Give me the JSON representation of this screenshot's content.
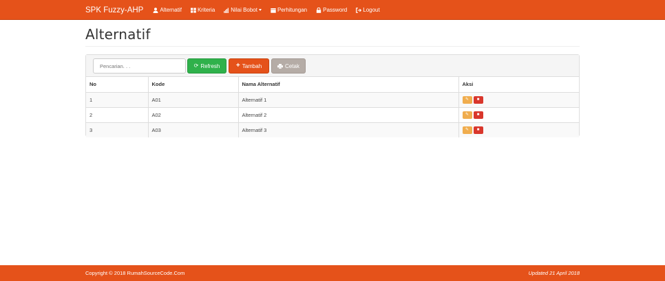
{
  "navbar": {
    "brand": "SPK Fuzzy-AHP",
    "items": [
      {
        "label": "Alternatif",
        "icon": "user-icon"
      },
      {
        "label": "Kriteria",
        "icon": "grid-icon"
      },
      {
        "label": "Nilai Bobot",
        "icon": "bar-chart-icon",
        "dropdown": true
      },
      {
        "label": "Perhitungan",
        "icon": "calendar-icon"
      },
      {
        "label": "Password",
        "icon": "lock-icon"
      },
      {
        "label": "Logout",
        "icon": "logout-icon"
      }
    ]
  },
  "page": {
    "title": "Alternatif"
  },
  "toolbar": {
    "search_placeholder": "Pencarian. . .",
    "refresh_label": "Refresh",
    "tambah_label": "Tambah",
    "cetak_label": "Cetak"
  },
  "table": {
    "headers": [
      "No",
      "Kode",
      "Nama Alternatif",
      "Aksi"
    ],
    "rows": [
      {
        "no": "1",
        "kode": "A01",
        "nama": "Alternatif 1"
      },
      {
        "no": "2",
        "kode": "A02",
        "nama": "Alternatif 2"
      },
      {
        "no": "3",
        "kode": "A03",
        "nama": "Alternatif 3"
      }
    ]
  },
  "footer": {
    "copyright": "Copyright © 2018 RumahSourceCode.Com",
    "updated": "Updated 21 April 2018"
  },
  "colors": {
    "brand": "#e5521a",
    "success": "#2fb14b",
    "muted": "#b5aca6",
    "warning": "#f0ad4e",
    "danger": "#d9372c"
  }
}
